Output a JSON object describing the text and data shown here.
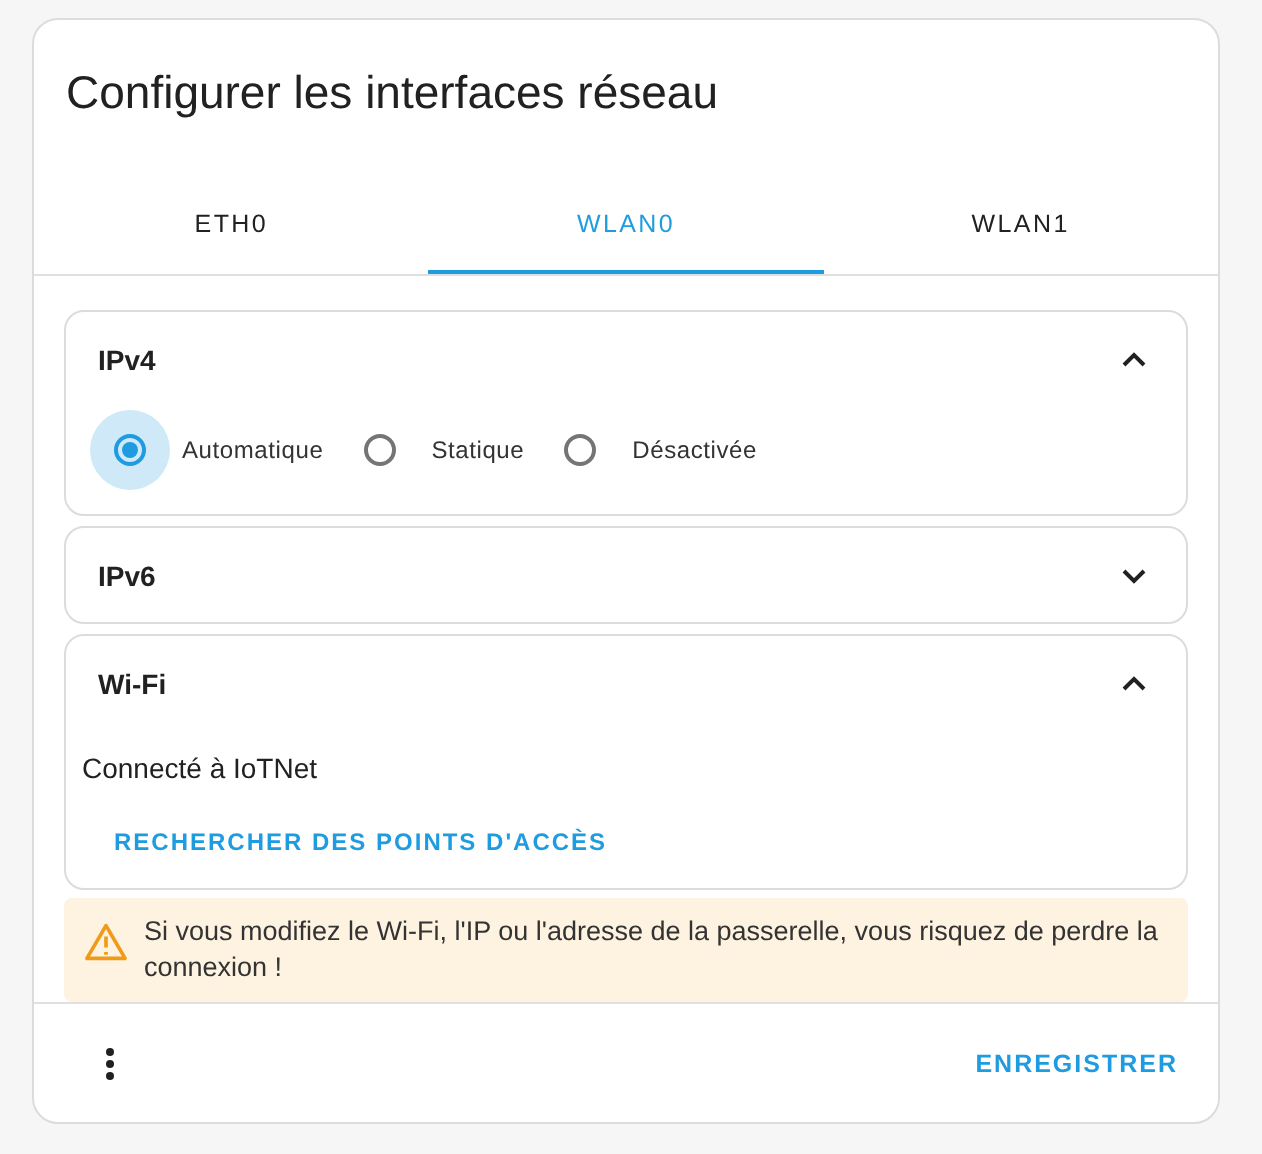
{
  "dialog": {
    "title": "Configurer les interfaces réseau"
  },
  "tabs": [
    {
      "label": "ETH0",
      "selected": false
    },
    {
      "label": "WLAN0",
      "selected": true
    },
    {
      "label": "WLAN1",
      "selected": false
    }
  ],
  "sections": [
    {
      "kind": "radios",
      "title": "IPv4",
      "expanded": true,
      "options": [
        {
          "label": "Automatique",
          "selected": true
        },
        {
          "label": "Statique",
          "selected": false
        },
        {
          "label": "Désactivée",
          "selected": false
        }
      ]
    },
    {
      "title": "IPv6",
      "expanded": false
    },
    {
      "kind": "wifi",
      "title": "Wi-Fi",
      "expanded": true,
      "status": "Connecté à IoTNet",
      "action": "RECHERCHER DES POINTS D'ACCÈS"
    }
  ],
  "warning": "Si vous modifiez le Wi-Fi, l'IP ou l'adresse de la passerelle, vous risquez de perdre la connexion !",
  "footer": {
    "save": "ENREGISTRER"
  }
}
